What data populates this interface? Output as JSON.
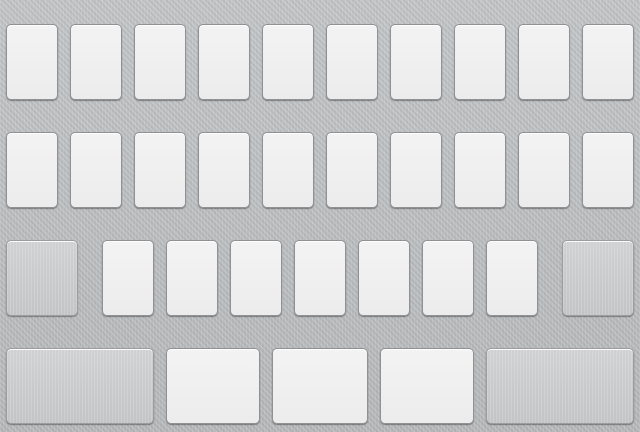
{
  "keyboard": {
    "background_color": "#b9bbbd",
    "letter_key_color": "#f0f0f0",
    "function_key_color": "#c9cacb",
    "rows": [
      {
        "name": "row-1",
        "keys": [
          {
            "label": "",
            "type": "letter"
          },
          {
            "label": "",
            "type": "letter"
          },
          {
            "label": "",
            "type": "letter"
          },
          {
            "label": "",
            "type": "letter"
          },
          {
            "label": "",
            "type": "letter"
          },
          {
            "label": "",
            "type": "letter"
          },
          {
            "label": "",
            "type": "letter"
          },
          {
            "label": "",
            "type": "letter"
          },
          {
            "label": "",
            "type": "letter"
          },
          {
            "label": "",
            "type": "letter"
          }
        ]
      },
      {
        "name": "row-2",
        "keys": [
          {
            "label": "",
            "type": "letter"
          },
          {
            "label": "",
            "type": "letter"
          },
          {
            "label": "",
            "type": "letter"
          },
          {
            "label": "",
            "type": "letter"
          },
          {
            "label": "",
            "type": "letter"
          },
          {
            "label": "",
            "type": "letter"
          },
          {
            "label": "",
            "type": "letter"
          },
          {
            "label": "",
            "type": "letter"
          },
          {
            "label": "",
            "type": "letter"
          },
          {
            "label": "",
            "type": "letter"
          }
        ]
      },
      {
        "name": "row-3",
        "keys": [
          {
            "label": "",
            "type": "function"
          },
          {
            "label": "",
            "type": "letter"
          },
          {
            "label": "",
            "type": "letter"
          },
          {
            "label": "",
            "type": "letter"
          },
          {
            "label": "",
            "type": "letter"
          },
          {
            "label": "",
            "type": "letter"
          },
          {
            "label": "",
            "type": "letter"
          },
          {
            "label": "",
            "type": "letter"
          },
          {
            "label": "",
            "type": "function"
          }
        ]
      },
      {
        "name": "row-4",
        "keys": [
          {
            "label": "",
            "type": "function"
          },
          {
            "label": "",
            "type": "letter"
          },
          {
            "label": "",
            "type": "letter"
          },
          {
            "label": "",
            "type": "letter"
          },
          {
            "label": "",
            "type": "function"
          }
        ]
      }
    ]
  }
}
